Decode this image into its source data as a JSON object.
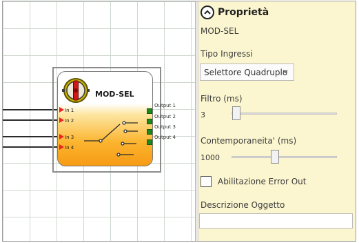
{
  "block": {
    "title": "MOD-SEL",
    "inputs": [
      "In 1",
      "In 2",
      "In 3",
      "In 4"
    ],
    "outputs": [
      "Output 1",
      "Output 2",
      "Output 3",
      "Output 4"
    ],
    "colors": {
      "input_arrow": "#ee2222",
      "output_port": "#1e8a1e",
      "body_bottom": "#f79b15"
    }
  },
  "panel": {
    "title": "Proprietà",
    "object_name": "MOD-SEL",
    "input_type": {
      "label": "Tipo Ingressi",
      "value": "Selettore Quadruplo"
    },
    "filter": {
      "label": "Filtro (ms)",
      "value": "3",
      "slider_fraction": 0.03
    },
    "simultaneity": {
      "label": "Contemporaneita' (ms)",
      "value": "1000",
      "slider_fraction": 0.4
    },
    "error_out": {
      "label": "Abilitazione Error Out",
      "checked": false
    },
    "description": {
      "label": "Descrizione Oggetto",
      "value": ""
    },
    "background": "#fbf6cf"
  }
}
